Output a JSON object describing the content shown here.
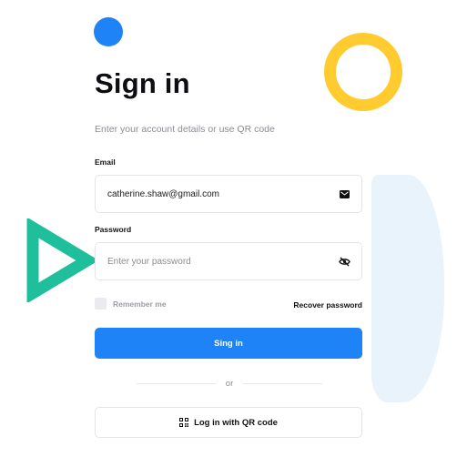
{
  "colors": {
    "accent": "#1e83f7",
    "ring": "#ffcb2f",
    "triangle": "#1fbf9c",
    "blob": "#e8f3fc"
  },
  "header": {
    "title": "Sign in",
    "subtitle": "Enter your account details or use QR code"
  },
  "form": {
    "email": {
      "label": "Email",
      "value": "catherine.shaw@gmail.com",
      "icon": "envelope-icon"
    },
    "password": {
      "label": "Password",
      "placeholder": "Enter your password",
      "icon": "eye-off-icon"
    },
    "remember_label": "Remember me",
    "remember_checked": false,
    "recover_label": "Recover password",
    "submit_label": "Sing in",
    "divider_text": "or",
    "qr_label": "Log in with QR code",
    "qr_icon": "qr-code-icon"
  }
}
